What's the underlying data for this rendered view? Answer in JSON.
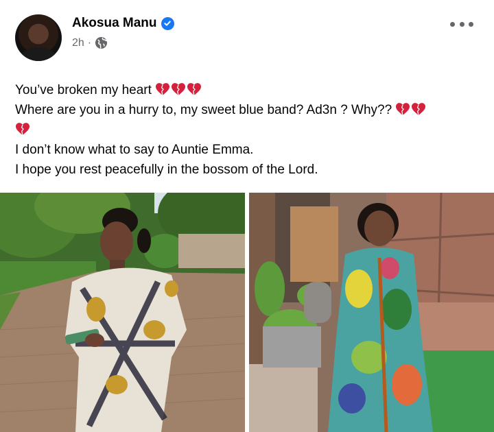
{
  "post": {
    "author": "Akosua Manu",
    "time": "2h",
    "separator": "·",
    "lines": [
      "You’ve broken my heart",
      "Where are you in a hurry to, my sweet blue band? Ad3n ? Why??",
      "I don’t know what to say to Auntie Emma.",
      "I hope you rest peacefully in the bossom of the Lord."
    ]
  },
  "icons": {
    "verified": "verified-badge-icon",
    "audience": "globe-icon",
    "more": "more-options-icon",
    "emoji": "broken-heart-emoji"
  },
  "colors": {
    "brand_blue": "#1877f2",
    "meta_gray": "#65676b",
    "heart_red": "#d4213d"
  }
}
